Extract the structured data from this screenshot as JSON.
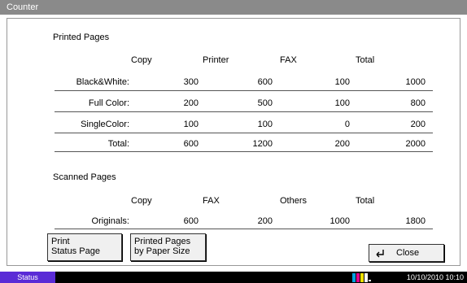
{
  "window": {
    "title": "Counter"
  },
  "printed": {
    "title": "Printed Pages",
    "headers": [
      "Copy",
      "Printer",
      "FAX",
      "Total"
    ],
    "rows": [
      {
        "label": "Black&White:",
        "values": [
          "300",
          "600",
          "100",
          "1000"
        ]
      },
      {
        "label": "Full Color:",
        "values": [
          "200",
          "500",
          "100",
          "800"
        ]
      },
      {
        "label": "SingleColor:",
        "values": [
          "100",
          "100",
          "0",
          "200"
        ]
      },
      {
        "label": "Total:",
        "values": [
          "600",
          "1200",
          "200",
          "2000"
        ]
      }
    ]
  },
  "scanned": {
    "title": "Scanned Pages",
    "headers": [
      "Copy",
      "FAX",
      "Others",
      "Total"
    ],
    "rows": [
      {
        "label": "Originals:",
        "values": [
          "600",
          "200",
          "1000",
          "1800"
        ]
      }
    ]
  },
  "buttons": {
    "print_status_line1": "Print",
    "print_status_line2": "Status Page",
    "by_paper_line1": "Printed Pages",
    "by_paper_line2": "by Paper Size",
    "close": "Close"
  },
  "statusbar": {
    "status_tab": "Status",
    "clock": "10/10/2010 10:10"
  },
  "icons": {
    "close": "enter-arrow-icon",
    "toner": "toner-level-icon"
  },
  "colors": {
    "status_tab": "#5a2bd6",
    "titlebar": "#8a8a8a"
  }
}
